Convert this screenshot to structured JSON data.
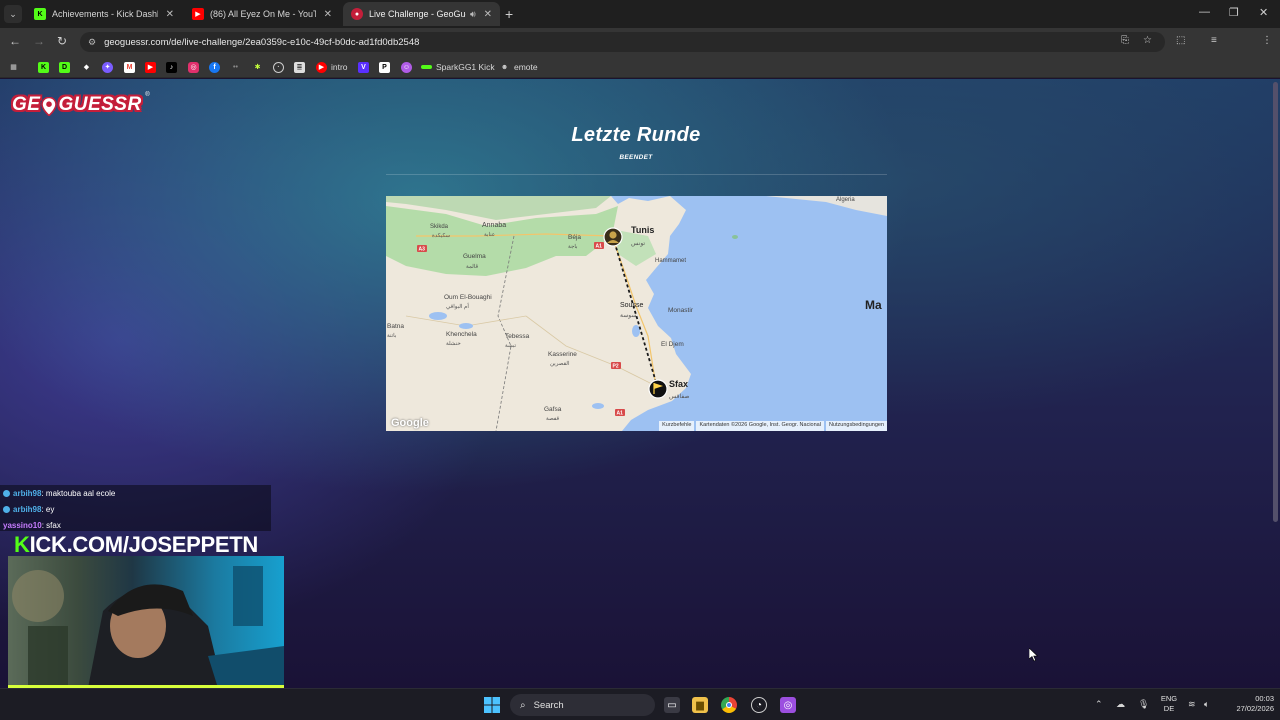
{
  "browser": {
    "tabs": [
      {
        "title": "Achievements - Kick Dashboard",
        "favicon": "kick-icon",
        "active": false
      },
      {
        "title": "(86) All Eyez On Me - YouTube",
        "favicon": "youtube-icon",
        "active": false
      },
      {
        "title": "Live Challenge - GeoGuessr",
        "favicon": "geoguessr-pin-icon",
        "active": true
      }
    ],
    "url": "geoguessr.com/de/live-challenge/2ea0359c-e10c-49cf-b0dc-ad1fd0db2548",
    "bookmarks": [
      {
        "label": "",
        "icon": "kick-icon",
        "color": "#53fc18"
      },
      {
        "label": "",
        "icon": "d-icon",
        "color": "#53fc18"
      },
      {
        "label": "",
        "icon": "diamond-icon",
        "color": "#ffffff"
      },
      {
        "label": "",
        "icon": "twitch-like-icon",
        "color": "#7a5cff"
      },
      {
        "label": "",
        "icon": "gmail-icon",
        "color": "#ea4335"
      },
      {
        "label": "",
        "icon": "youtube-icon",
        "color": "#ff0000"
      },
      {
        "label": "",
        "icon": "tiktok-icon",
        "color": "#ffffff"
      },
      {
        "label": "",
        "icon": "instagram-icon",
        "color": "#e1306c"
      },
      {
        "label": "",
        "icon": "facebook-icon",
        "color": "#1877f2"
      },
      {
        "label": "",
        "icon": "dots-icon",
        "color": "#888888"
      },
      {
        "label": "",
        "icon": "bolt-icon",
        "color": "#c4ff3b"
      },
      {
        "label": "",
        "icon": "circle-icon",
        "color": "#cccccc"
      },
      {
        "label": "",
        "icon": "doc-icon",
        "color": "#dddddd"
      },
      {
        "label": "intro",
        "icon": "youtube-icon",
        "color": "#ff0000"
      },
      {
        "label": "",
        "icon": "v-icon",
        "color": "#5a2fff"
      },
      {
        "label": "",
        "icon": "p-icon",
        "color": "#ffffff"
      },
      {
        "label": "",
        "icon": "discord-like-icon",
        "color": "#b05ce6"
      },
      {
        "label": "SparkGG1 Kick",
        "icon": "kick-bar-icon",
        "color": "#53fc18"
      },
      {
        "label": "emote",
        "icon": "emote-icon",
        "color": "#cccccc"
      }
    ]
  },
  "page": {
    "logo": "GEOGUESSR",
    "title": "Letzte Runde",
    "subtitle": "BEENDET",
    "map": {
      "places": [
        "Tunis",
        "Hammamet",
        "Sousse",
        "Monastir",
        "El Djem",
        "Sfax",
        "Annaba",
        "Béja",
        "Guelma",
        "Skikda",
        "Oum El-Bouaghi",
        "Khenchela",
        "Tebessa",
        "Kasserine",
        "Gafsa",
        "Batna",
        "Ma",
        "Algeria"
      ],
      "arabic_labels": [
        "تونس",
        "سوسة",
        "صفاقس",
        "ڨالمة",
        "عنابة",
        "باجة",
        "خنشلة",
        "القصرين",
        "قفصة",
        "أم البواقي",
        "سكيكدة",
        "تبسة",
        "باتنة"
      ],
      "route_signs": [
        "A3",
        "A1",
        "P2",
        "A1"
      ],
      "attribution": [
        "Kurzbefehle",
        "Kartendaten ©2026 Google, Inst. Geogr. Nacional",
        "Nutzungsbedingungen"
      ],
      "google_logo": "Google"
    }
  },
  "stream_overlay": {
    "chat": [
      {
        "user": "arbih98",
        "message": " : maktouba aal ecole",
        "user_color": "#4fb0e8"
      },
      {
        "user": "arbih98",
        "message": " : ey",
        "user_color": "#4fb0e8"
      },
      {
        "user": "yassino10",
        "message": " : sfax",
        "user_color": "#c77dff"
      }
    ],
    "banner_k": "K",
    "banner_rest": "ICK.COM/JOSEPPETN"
  },
  "taskbar": {
    "search_placeholder": "Search",
    "lang_line1": "ENG",
    "lang_line2": "DE",
    "time": "00:03",
    "date": "27/02/2026"
  }
}
